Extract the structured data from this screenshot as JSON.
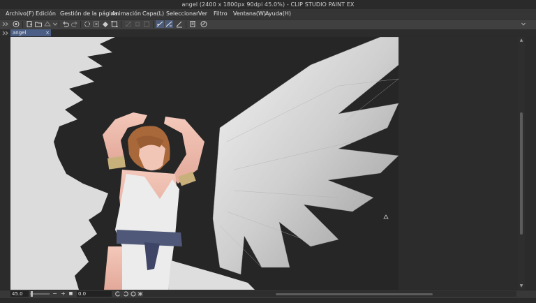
{
  "window": {
    "title": "angel (2400 x 1800px 90dpi 45.0%)  - CLIP STUDIO PAINT EX"
  },
  "menu": [
    "Archivo(F)",
    "Edición",
    "Gestión de la página",
    "Animación",
    "Capa(L)",
    "Seleccionar",
    "Ver",
    "Filtro",
    "Ventana(W)",
    "Ayuda(H)"
  ],
  "toolbar": {
    "icons": [
      "navigator-icon",
      "new-file-icon",
      "open-file-icon",
      "save-icon",
      "dropdown-icon",
      "undo-icon",
      "redo-icon",
      "clear-icon",
      "clear-outside-icon",
      "fill-icon",
      "transform-icon",
      "deselect-icon",
      "invert-selection-icon",
      "show-selection-icon",
      "snap-ruler-icon",
      "snap-special-ruler-icon",
      "snap-grid-icon",
      "settings-icon",
      "clip-icon"
    ]
  },
  "tab": {
    "label": "angel",
    "close": "×"
  },
  "status": {
    "zoom": "45.0",
    "rotation": "0.0",
    "zoom_out": "−",
    "zoom_in": "+",
    "zoom_fit": "■"
  },
  "scroll": {
    "up": "▲",
    "down": "▼"
  },
  "colors": {
    "menubar": "#353535",
    "toolbar": "#404040",
    "tab_active": "#4b5e86",
    "canvas_bg": "#2c2c2c",
    "artwork_bg": "#262626"
  }
}
